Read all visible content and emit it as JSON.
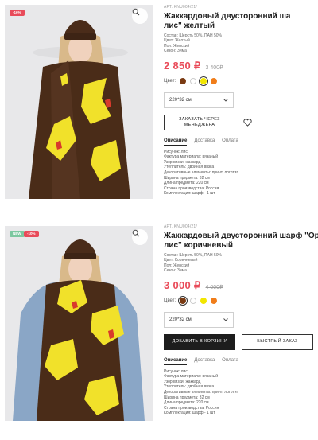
{
  "products": [
    {
      "badges": [
        {
          "text": "-16%",
          "color": "#e84b5a"
        }
      ],
      "article": "АРТ. KNU004/21/",
      "title_lines": [
        "Жаккардовый двусторонний ша",
        "лис\" желтый"
      ],
      "specs": [
        "Состав: Шерсть 50%, ПАН 50%",
        "Цвет: Желтый",
        "Пол: Женский",
        "Сезон: Зима"
      ],
      "price": "2 850 ₽",
      "old_price": "3 400₽",
      "color_label": "Цвет:",
      "swatches": [
        {
          "color": "#7a3a12",
          "selected": false
        },
        {
          "color": "#ffffff",
          "selected": false
        },
        {
          "color": "#f2e600",
          "selected": true
        },
        {
          "color": "#f07d1a",
          "selected": false
        }
      ],
      "size": "220*32 см",
      "buttons": [
        "ЗАКАЗАТЬ ЧЕРЕЗ МЕНЕДЖЕРА"
      ],
      "tabs": [
        "Описание",
        "Доставка",
        "Оплата"
      ],
      "description": [
        "Рисунок: лис",
        "Фактура материала: вязаный",
        "Узор вязки: жаккард",
        "Утеплитель: двойная вязка",
        "Декоративные элементы: принт, логотип",
        "Ширина предмета: 32 см",
        "Длина предмета: 220 см",
        "Страна производства: Россия",
        "Комплектация: шарф - 1 шт."
      ]
    },
    {
      "badges": [
        {
          "text": "NEW",
          "color": "#7cc8a0"
        },
        {
          "text": "-10%",
          "color": "#e84b5a"
        }
      ],
      "article": "АРТ. KNU004/21/",
      "title_lines": [
        "Жаккардовый двусторонний шарф \"Ору",
        "лис\" коричневый"
      ],
      "specs": [
        "Состав: Шерсть 50%, ПАН 50%",
        "Цвет: Коричневый",
        "Пол: Женский",
        "Сезон: Зима"
      ],
      "price": "3 000 ₽",
      "old_price": "4 000₽",
      "color_label": "Цвет:",
      "swatches": [
        {
          "color": "#7a3a12",
          "selected": true
        },
        {
          "color": "#ffffff",
          "selected": false
        },
        {
          "color": "#f2e600",
          "selected": false
        },
        {
          "color": "#f07d1a",
          "selected": false
        }
      ],
      "size": "220*32 см",
      "buttons": [
        "ДОБАВИТЬ В КОРЗИНУ",
        "БЫСТРЫЙ ЗАКАЗ"
      ],
      "tabs": [
        "Описание",
        "Доставка",
        "Оплата"
      ],
      "description": [
        "Рисунок: лис",
        "Фактура материала: вязаный",
        "Узор вязки: жаккард",
        "Утеплитель: двойная вязка",
        "Декоративные элементы: принт, логотип",
        "Ширина предмета: 32 см",
        "Длина предмета: 220 см",
        "Страна производства: Россия",
        "Комплектация: шарф - 1 шт."
      ]
    }
  ]
}
